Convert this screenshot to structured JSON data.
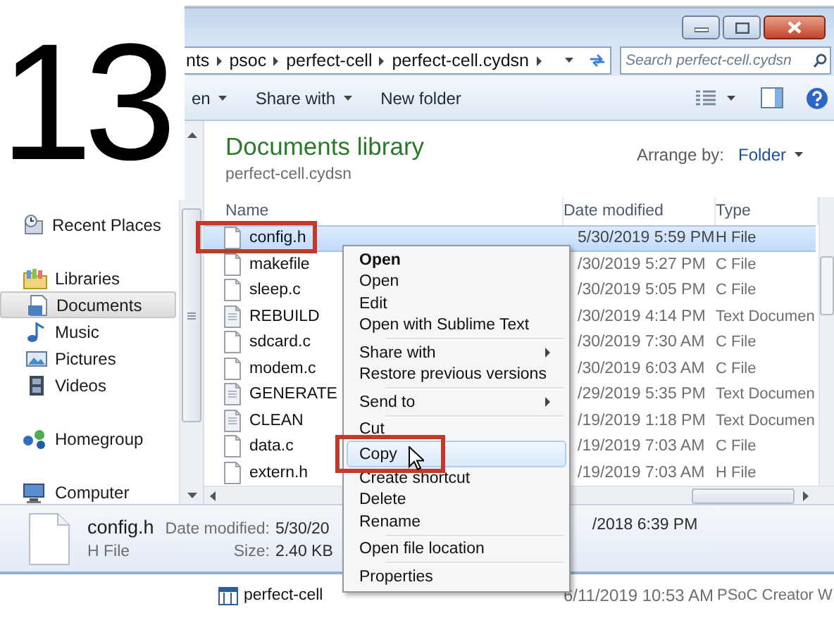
{
  "step_number": "13",
  "address_bar": {
    "breadcrumbs": [
      "nts",
      "psoc",
      "perfect-cell",
      "perfect-cell.cydsn"
    ]
  },
  "search": {
    "placeholder": "Search perfect-cell.cydsn"
  },
  "toolbar": {
    "buttons": [
      {
        "label": "en",
        "dropdown": true
      },
      {
        "label": "Share with",
        "dropdown": true
      },
      {
        "label": "New folder",
        "dropdown": false
      }
    ]
  },
  "nav_pane": {
    "items": [
      {
        "label": "Recent Places",
        "selected": false
      },
      {
        "label": "Libraries",
        "selected": false,
        "children": [
          {
            "label": "Documents",
            "selected": true
          },
          {
            "label": "Music",
            "selected": false
          },
          {
            "label": "Pictures",
            "selected": false
          },
          {
            "label": "Videos",
            "selected": false
          }
        ]
      },
      {
        "label": "Homegroup",
        "selected": false
      },
      {
        "label": "Computer",
        "selected": false
      }
    ]
  },
  "library": {
    "title": "Documents library",
    "subtitle": "perfect-cell.cydsn",
    "arrange_label": "Arrange by:",
    "arrange_value": "Folder"
  },
  "table": {
    "columns": [
      "Name",
      "Date modified",
      "Type"
    ],
    "rows": [
      {
        "name": "config.h",
        "date": "5/30/2019 5:59 PM",
        "type": "H File",
        "kind": "code",
        "selected": true,
        "highlighted": true
      },
      {
        "name": "makefile",
        "date": "/30/2019 5:27 PM",
        "type": "C File",
        "kind": "code",
        "selected": false,
        "highlighted": false
      },
      {
        "name": "sleep.c",
        "date": "/30/2019 5:05 PM",
        "type": "C File",
        "kind": "code",
        "selected": false,
        "highlighted": false
      },
      {
        "name": "REBUILD",
        "date": "/30/2019 4:14 PM",
        "type": "Text Documen",
        "kind": "text",
        "selected": false,
        "highlighted": false
      },
      {
        "name": "sdcard.c",
        "date": "/30/2019 7:30 AM",
        "type": "C File",
        "kind": "code",
        "selected": false,
        "highlighted": false
      },
      {
        "name": "modem.c",
        "date": "/30/2019 6:03 AM",
        "type": "C File",
        "kind": "code",
        "selected": false,
        "highlighted": false
      },
      {
        "name": "GENERATE",
        "date": "/29/2019 5:35 PM",
        "type": "Text Documen",
        "kind": "text",
        "selected": false,
        "highlighted": false
      },
      {
        "name": "CLEAN",
        "date": "/19/2019 1:18 PM",
        "type": "Text Documen",
        "kind": "text",
        "selected": false,
        "highlighted": false
      },
      {
        "name": "data.c",
        "date": "/19/2019 7:03 AM",
        "type": "C File",
        "kind": "code",
        "selected": false,
        "highlighted": false
      },
      {
        "name": "extern.h",
        "date": "/19/2019 7:03 AM",
        "type": "H File",
        "kind": "code",
        "selected": false,
        "highlighted": false
      }
    ]
  },
  "context_menu": {
    "items": [
      {
        "kind": "item",
        "label": "Open",
        "bold": true,
        "submenu": false,
        "hovered": false,
        "highlighted": false
      },
      {
        "kind": "item",
        "label": "Open",
        "bold": false,
        "submenu": false,
        "hovered": false,
        "highlighted": false
      },
      {
        "kind": "item",
        "label": "Edit",
        "bold": false,
        "submenu": false,
        "hovered": false,
        "highlighted": false
      },
      {
        "kind": "item",
        "label": "Open with Sublime Text",
        "bold": false,
        "submenu": false,
        "hovered": false,
        "highlighted": false
      },
      {
        "kind": "separator"
      },
      {
        "kind": "item",
        "label": "Share with",
        "bold": false,
        "submenu": true,
        "hovered": false,
        "highlighted": false
      },
      {
        "kind": "item",
        "label": "Restore previous versions",
        "bold": false,
        "submenu": false,
        "hovered": false,
        "highlighted": false
      },
      {
        "kind": "separator"
      },
      {
        "kind": "item",
        "label": "Send to",
        "bold": false,
        "submenu": true,
        "hovered": false,
        "highlighted": false
      },
      {
        "kind": "separator"
      },
      {
        "kind": "item",
        "label": "Cut",
        "bold": false,
        "submenu": false,
        "hovered": false,
        "highlighted": false
      },
      {
        "kind": "item",
        "label": "Copy",
        "bold": false,
        "submenu": false,
        "hovered": true,
        "highlighted": true
      },
      {
        "kind": "item",
        "label": "Create shortcut",
        "bold": false,
        "submenu": false,
        "hovered": false,
        "highlighted": false
      },
      {
        "kind": "item",
        "label": "Delete",
        "bold": false,
        "submenu": false,
        "hovered": false,
        "highlighted": false
      },
      {
        "kind": "item",
        "label": "Rename",
        "bold": false,
        "submenu": false,
        "hovered": false,
        "highlighted": false
      },
      {
        "kind": "separator"
      },
      {
        "kind": "item",
        "label": "Open file location",
        "bold": false,
        "submenu": false,
        "hovered": false,
        "highlighted": false
      },
      {
        "kind": "separator"
      },
      {
        "kind": "item",
        "label": "Properties",
        "bold": false,
        "submenu": false,
        "hovered": false,
        "highlighted": false
      }
    ]
  },
  "details": {
    "name": "config.h",
    "type": "H File",
    "date_label": "Date modified:",
    "date_value": "5/30/20",
    "date_rest": "/2018 6:39 PM",
    "size_label": "Size:",
    "size_value": "2.40 KB"
  },
  "back_window": {
    "rows": [
      {
        "name": "perfect-cell",
        "date": "6/11/2019 10:53 AM",
        "type": "PSoC Creator W"
      }
    ]
  }
}
